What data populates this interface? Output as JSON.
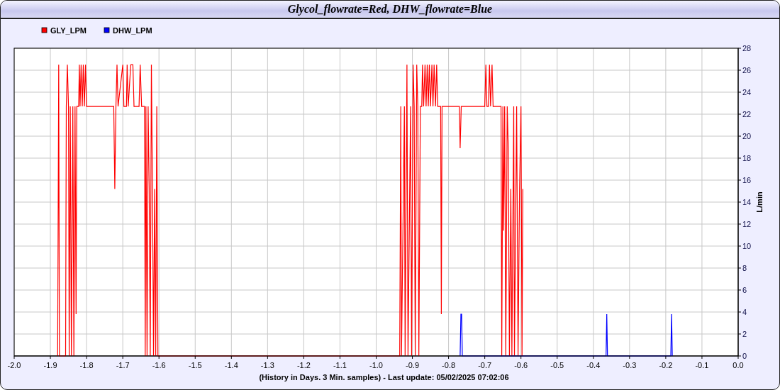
{
  "chart": {
    "chart_data": {
      "type": "line",
      "title": "Glycol_flowrate=Red, DHW_flowrate=Blue",
      "xlabel": "(History in Days. 3 Min. samples) - Last update: 05/02/2025 07:02:06",
      "ylabel": "L/min",
      "grid": true,
      "legend": "top-left",
      "xlim": [
        -2,
        0
      ],
      "ylim": [
        0,
        28
      ],
      "xticks": [
        {
          "value": -2,
          "label": "-2.0"
        },
        {
          "value": -1.9,
          "label": "-1.9"
        },
        {
          "value": -1.8,
          "label": "-1.8"
        },
        {
          "value": -1.7,
          "label": "-1.7"
        },
        {
          "value": -1.6,
          "label": "-1.6"
        },
        {
          "value": -1.5,
          "label": "-1.5"
        },
        {
          "value": -1.4,
          "label": "-1.4"
        },
        {
          "value": -1.3,
          "label": "-1.3"
        },
        {
          "value": -1.2,
          "label": "-1.2"
        },
        {
          "value": -1.1,
          "label": "-1.1"
        },
        {
          "value": -1,
          "label": "-1.0"
        },
        {
          "value": -0.9,
          "label": "-0.9"
        },
        {
          "value": -0.8,
          "label": "-0.8"
        },
        {
          "value": -0.7,
          "label": "-0.7"
        },
        {
          "value": -0.6,
          "label": "-0.6"
        },
        {
          "value": -0.5,
          "label": "-0.5"
        },
        {
          "value": -0.4,
          "label": "-0.4"
        },
        {
          "value": -0.3,
          "label": "-0.3"
        },
        {
          "value": -0.2,
          "label": "-0.2"
        },
        {
          "value": -0.1,
          "label": "-0.1"
        },
        {
          "value": 0,
          "label": "0.0"
        }
      ],
      "yticks": [
        0,
        2,
        4,
        6,
        8,
        10,
        12,
        14,
        16,
        18,
        20,
        22,
        24,
        26,
        28
      ],
      "series": [
        {
          "name": "GLY_LPM",
          "color": "#ff0000",
          "x": [
            -1.88,
            -1.877,
            -1.875,
            -1.858,
            -1.856,
            -1.853,
            -1.85,
            -1.848,
            -1.845,
            -1.842,
            -1.838,
            -1.835,
            -1.832,
            -1.829,
            -1.827,
            -1.822,
            -1.82,
            -1.818,
            -1.815,
            -1.812,
            -1.809,
            -1.806,
            -1.803,
            -1.8,
            -1.725,
            -1.722,
            -1.719,
            -1.716,
            -1.713,
            -1.7,
            -1.697,
            -1.69,
            -1.688,
            -1.685,
            -1.678,
            -1.672,
            -1.669,
            -1.655,
            -1.652,
            -1.648,
            -1.64,
            -1.638,
            -1.636,
            -1.633,
            -1.63,
            -1.627,
            -1.624,
            -1.621,
            -1.618,
            -1.615,
            -1.612,
            -1.609,
            -1.606,
            -1.603,
            -0.935,
            -0.932,
            -0.93,
            -0.922,
            -0.92,
            -0.915,
            -0.912,
            -0.905,
            -0.902,
            -0.898,
            -0.895,
            -0.892,
            -0.888,
            -0.885,
            -0.882,
            -0.878,
            -0.874,
            -0.872,
            -0.869,
            -0.865,
            -0.862,
            -0.859,
            -0.856,
            -0.853,
            -0.85,
            -0.846,
            -0.843,
            -0.84,
            -0.836,
            -0.833,
            -0.83,
            -0.822,
            -0.82,
            -0.818,
            -0.77,
            -0.768,
            -0.765,
            -0.7,
            -0.697,
            -0.694,
            -0.69,
            -0.687,
            -0.684,
            -0.68,
            -0.677,
            -0.655,
            -0.653,
            -0.65,
            -0.648,
            -0.645,
            -0.642,
            -0.638,
            -0.635,
            -0.632,
            -0.628,
            -0.625,
            -0.62,
            -0.618,
            -0.612,
            -0.608,
            -0.604,
            -0.6,
            -0.597,
            -0.595
          ],
          "values": [
            0,
            26.5,
            0,
            0,
            22.7,
            26.5,
            22.7,
            0,
            22.7,
            0,
            22.7,
            0,
            22.7,
            3.8,
            22.7,
            22.7,
            26.5,
            22.7,
            26.5,
            22.7,
            26.5,
            22.7,
            26.5,
            22.7,
            22.7,
            15.2,
            22.7,
            26.5,
            22.7,
            26.5,
            22.7,
            22.7,
            26.5,
            22.7,
            26.5,
            26.5,
            22.7,
            22.7,
            26.5,
            22.7,
            22.7,
            0,
            22.7,
            0,
            22.7,
            15.2,
            0,
            26.5,
            15.2,
            0,
            15.2,
            0,
            22.7,
            0,
            0,
            22.7,
            0,
            22.7,
            0,
            26.5,
            0,
            22.7,
            0,
            26.5,
            22.7,
            0,
            26.5,
            22.7,
            0,
            22.7,
            22.7,
            26.5,
            22.7,
            26.5,
            22.7,
            26.5,
            22.7,
            26.5,
            22.7,
            26.5,
            22.7,
            26.5,
            22.7,
            26.5,
            22.7,
            22.7,
            3.8,
            22.7,
            22.7,
            18.9,
            22.7,
            22.7,
            26.5,
            22.7,
            22.7,
            26.5,
            22.7,
            26.5,
            22.7,
            22.7,
            0,
            22.7,
            11.4,
            22.7,
            0,
            22.7,
            18.9,
            0,
            15.2,
            0,
            22.7,
            0,
            22.7,
            0,
            15.2,
            22.7,
            0,
            15.2
          ]
        },
        {
          "name": "DHW_LPM",
          "color": "#0000ff",
          "x": [
            -0.768,
            -0.766,
            -0.764,
            -0.762,
            -0.365,
            -0.363,
            -0.361,
            -0.186,
            -0.184,
            -0.182
          ],
          "values": [
            0,
            3.8,
            3.8,
            0,
            0,
            3.8,
            0,
            0,
            3.8,
            0
          ]
        }
      ]
    }
  }
}
